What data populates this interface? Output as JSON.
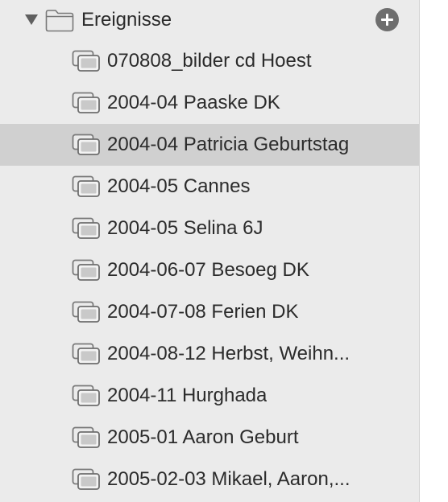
{
  "sidebar": {
    "group": {
      "label": "Ereignisse",
      "expanded": true,
      "icon": "folder-icon",
      "add_icon": "plus-circle-icon"
    },
    "selected_index": 2,
    "items": [
      {
        "label": "070808_bilder cd Hoest",
        "icon": "album-stack-icon"
      },
      {
        "label": "2004-04 Paaske DK",
        "icon": "album-stack-icon"
      },
      {
        "label": "2004-04 Patricia Geburtstag",
        "icon": "album-stack-icon"
      },
      {
        "label": "2004-05 Cannes",
        "icon": "album-stack-icon"
      },
      {
        "label": "2004-05 Selina 6J",
        "icon": "album-stack-icon"
      },
      {
        "label": "2004-06-07 Besoeg DK",
        "icon": "album-stack-icon"
      },
      {
        "label": "2004-07-08 Ferien DK",
        "icon": "album-stack-icon"
      },
      {
        "label": "2004-08-12 Herbst, Weihn...",
        "icon": "album-stack-icon"
      },
      {
        "label": "2004-11 Hurghada",
        "icon": "album-stack-icon"
      },
      {
        "label": "2005-01 Aaron Geburt",
        "icon": "album-stack-icon"
      },
      {
        "label": "2005-02-03 Mikael, Aaron,...",
        "icon": "album-stack-icon"
      }
    ]
  },
  "colors": {
    "sidebar_bg": "#ebebeb",
    "selection_bg": "#d0d0d0",
    "text": "#2b2b2b",
    "icon": "#6e6e6e"
  }
}
